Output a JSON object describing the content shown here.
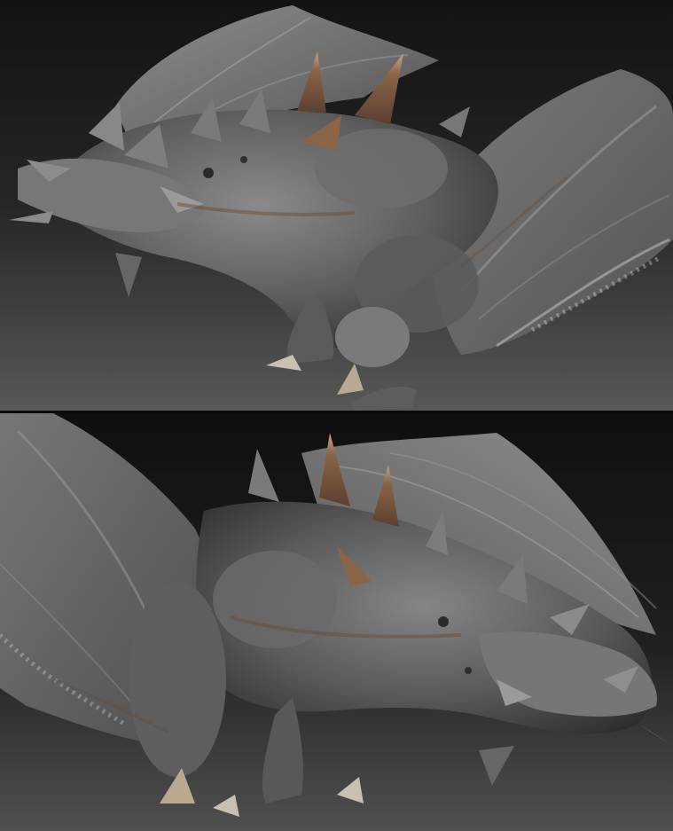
{
  "colors": {
    "backdrop_top": "#141414",
    "backdrop_bottom": "#555555",
    "hide_light": "#8a8a8a",
    "hide_mid": "#6a6a6a",
    "hide_dark": "#3e3e3e",
    "horn": "#7a5a3e",
    "horn_tip": "#b89a78",
    "membrane": "#5c5c5c",
    "membrane_edge": "#d8d8d8"
  },
  "views": [
    {
      "label": "",
      "facing": "left"
    },
    {
      "label": "",
      "facing": "right"
    }
  ]
}
